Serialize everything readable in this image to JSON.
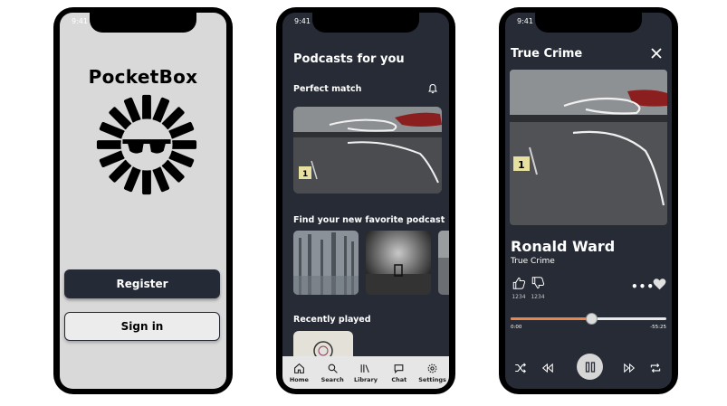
{
  "status_time": "9:41",
  "login": {
    "brand": "PocketBox",
    "register_label": "Register",
    "signin_label": "Sign in"
  },
  "discover": {
    "title": "Podcasts for you",
    "perfect_match": "Perfect match",
    "find_new": "Find your new favorite podcast",
    "recently_played": "Recently played",
    "tabs": [
      {
        "label": "Home",
        "icon": "home-icon"
      },
      {
        "label": "Search",
        "icon": "search-icon"
      },
      {
        "label": "Library",
        "icon": "library-icon"
      },
      {
        "label": "Chat",
        "icon": "chat-icon"
      },
      {
        "label": "Settings",
        "icon": "settings-icon"
      }
    ]
  },
  "player": {
    "header": "True Crime",
    "track_title": "Ronald Ward",
    "track_category": "True Crime",
    "likes": "1234",
    "dislikes": "1234",
    "more": "•••",
    "time_elapsed": "0:00",
    "time_remaining": "-55:25",
    "progress": 0.52
  },
  "colors": {
    "dark_bg": "#262b36",
    "light_bg": "#d9d9d9",
    "accent": "#e9864a",
    "tabbar": "#e6e6e6"
  }
}
